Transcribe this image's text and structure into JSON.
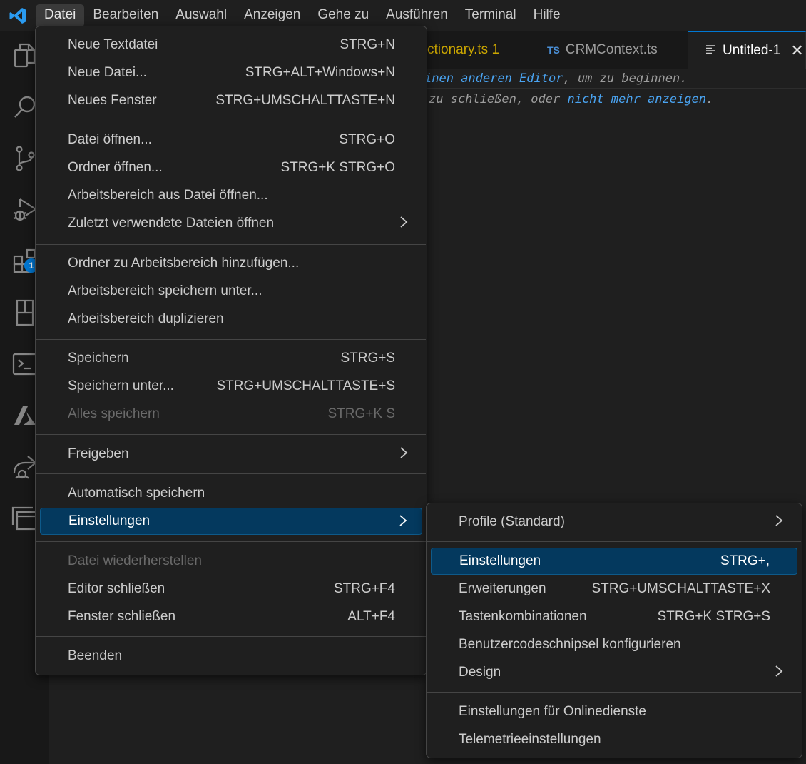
{
  "menubar": {
    "items": [
      "Datei",
      "Bearbeiten",
      "Auswahl",
      "Anzeigen",
      "Gehe zu",
      "Ausführen",
      "Terminal",
      "Hilfe"
    ],
    "active": "Datei"
  },
  "activity_bar": {
    "icons": [
      "explorer-icon",
      "search-icon",
      "source-control-icon",
      "run-debug-icon",
      "extensions-icon",
      "remote-explorer-icon",
      "terminal-icon",
      "azure-icon",
      "live-share-icon",
      "panel-icon"
    ],
    "extensions_badge": "1"
  },
  "tabs": [
    {
      "label": "ctionary.ts 1"
    },
    {
      "prefix": "TS",
      "label": "CRMContext.ts"
    },
    {
      "label": "Untitled-1",
      "close": "✕"
    }
  ],
  "editor": {
    "line1_a": "inen anderen Editor",
    "line1_b": ", um zu beginnen.",
    "line2_a": " zu schließen, oder ",
    "line2_b": "nicht mehr anzeigen",
    "line2_c": "."
  },
  "file_menu": {
    "new_text_file": {
      "label": "Neue Textdatei",
      "key": "STRG+N"
    },
    "new_file": {
      "label": "Neue Datei...",
      "key": "STRG+ALT+Windows+N"
    },
    "new_window": {
      "label": "Neues Fenster",
      "key": "STRG+UMSCHALTTASTE+N"
    },
    "open_file": {
      "label": "Datei öffnen...",
      "key": "STRG+O"
    },
    "open_folder": {
      "label": "Ordner öffnen...",
      "key": "STRG+K STRG+O"
    },
    "open_workspace": {
      "label": "Arbeitsbereich aus Datei öffnen..."
    },
    "open_recent": {
      "label": "Zuletzt verwendete Dateien öffnen"
    },
    "add_folder": {
      "label": "Ordner zu Arbeitsbereich hinzufügen..."
    },
    "save_workspace_as": {
      "label": "Arbeitsbereich speichern unter..."
    },
    "duplicate_workspace": {
      "label": "Arbeitsbereich duplizieren"
    },
    "save": {
      "label": "Speichern",
      "key": "STRG+S"
    },
    "save_as": {
      "label": "Speichern unter...",
      "key": "STRG+UMSCHALTTASTE+S"
    },
    "save_all": {
      "label": "Alles speichern",
      "key": "STRG+K S"
    },
    "share": {
      "label": "Freigeben"
    },
    "auto_save": {
      "label": "Automatisch speichern"
    },
    "preferences": {
      "label": "Einstellungen"
    },
    "revert_file": {
      "label": "Datei wiederherstellen"
    },
    "close_editor": {
      "label": "Editor schließen",
      "key": "STRG+F4"
    },
    "close_window": {
      "label": "Fenster schließen",
      "key": "ALT+F4"
    },
    "exit": {
      "label": "Beenden"
    }
  },
  "preferences_menu": {
    "profile": {
      "label": "Profile (Standard)"
    },
    "settings": {
      "label": "Einstellungen",
      "key": "STRG+,"
    },
    "extensions": {
      "label": "Erweiterungen",
      "key": "STRG+UMSCHALTTASTE+X"
    },
    "keybindings": {
      "label": "Tastenkombinationen",
      "key": "STRG+K STRG+S"
    },
    "snippets": {
      "label": "Benutzercodeschnipsel konfigurieren"
    },
    "theme": {
      "label": "Design"
    },
    "online_services": {
      "label": "Einstellungen für Onlinedienste"
    },
    "telemetry": {
      "label": "Telemetrieeinstellungen"
    }
  },
  "colors": {
    "accent": "#0078d4",
    "highlight": "#04395e",
    "warning_tab": "#cca700",
    "link": "#4aa4f2"
  }
}
